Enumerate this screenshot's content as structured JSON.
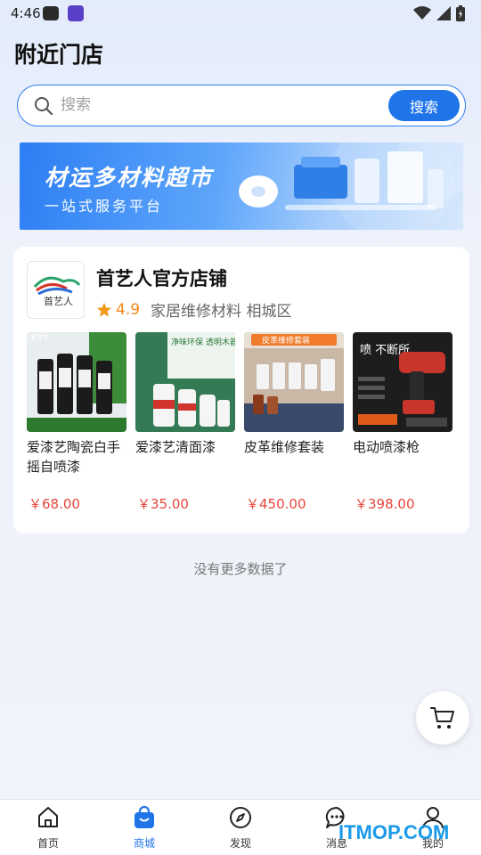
{
  "status_bar": {
    "time": "4:46"
  },
  "page_title": "附近门店",
  "search": {
    "placeholder": "搜索",
    "button_label": "搜索"
  },
  "banner": {
    "title": "材运多材料超市",
    "subtitle": "一站式服务平台"
  },
  "store": {
    "name": "首艺人官方店铺",
    "logo_text": "首艺人",
    "rating": "4.9",
    "meta": "家居维修材料 相城区",
    "products": [
      {
        "name": "爱漆艺陶瓷白手摇自喷漆",
        "price": "￥68.00",
        "image_text": "爱漆艺"
      },
      {
        "name": "爱漆艺清面漆",
        "price": "￥35.00",
        "image_text": "净味环保 透明木器自喷漆"
      },
      {
        "name": "皮革维修套装",
        "price": "￥450.00",
        "image_text": "皮革维修套装"
      },
      {
        "name": "电动喷漆枪",
        "price": "￥398.00",
        "image_text": "喷 不断所"
      }
    ]
  },
  "no_more_text": "没有更多数据了",
  "tabbar": {
    "items": [
      {
        "label": "首页",
        "icon": "home-icon"
      },
      {
        "label": "商城",
        "icon": "shopping-bag-icon"
      },
      {
        "label": "发现",
        "icon": "compass-icon"
      },
      {
        "label": "消息",
        "icon": "chat-icon"
      },
      {
        "label": "我的",
        "icon": "user-icon"
      }
    ],
    "active": "商城"
  },
  "watermark": "ITMOP.COM",
  "colors": {
    "accent": "#1f74e8",
    "price": "#e7453b",
    "rating": "#f0891a"
  }
}
